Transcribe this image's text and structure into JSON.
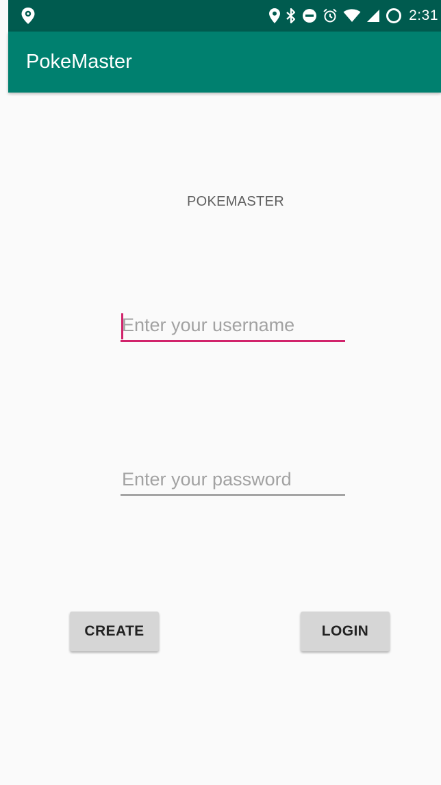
{
  "status_bar": {
    "time": "2:31",
    "icons": [
      "location-pin-icon",
      "bluetooth-icon",
      "do-not-disturb-icon",
      "alarm-icon",
      "wifi-icon",
      "cellular-signal-icon",
      "sync-icon"
    ],
    "left_icon": "location-marker-icon"
  },
  "app_bar": {
    "title": "PokeMaster"
  },
  "main": {
    "heading": "POKEMASTER",
    "username": {
      "value": "",
      "placeholder": "Enter your username"
    },
    "password": {
      "value": "",
      "placeholder": "Enter your password"
    },
    "create_label": "CREATE",
    "login_label": "LOGIN"
  },
  "colors": {
    "status_bar": "#005b4f",
    "app_bar": "#00806f",
    "accent": "#d1236b",
    "background": "#fafafa",
    "button": "#d6d6d6"
  }
}
